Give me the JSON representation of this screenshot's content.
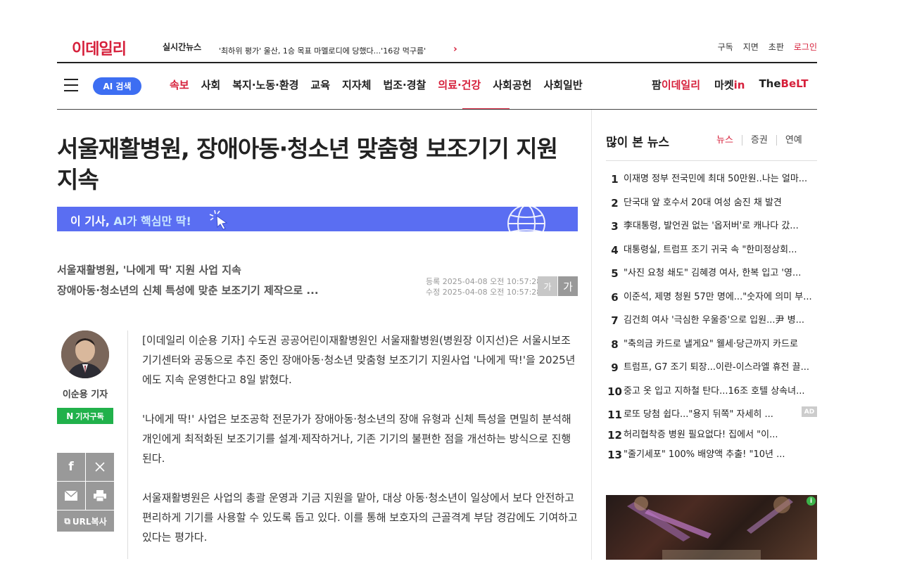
{
  "header": {
    "logo": "이데일리",
    "live_label": "실시간뉴스",
    "live_ticker": "'최하위 평가' 울산, 1승 목표 마멜로디에 당했다...'16강 먹구름'",
    "live_ticker_prev": "",
    "util_links": [
      "구독",
      "지면",
      "초판"
    ],
    "login": "로그인"
  },
  "nav": {
    "ai_search": "AI 검색",
    "items": [
      "속보",
      "사회",
      "복지·노동·환경",
      "교육",
      "지자체",
      "법조·경찰",
      "의료·건강",
      "사회공헌",
      "사회일반"
    ],
    "active_item": "의료·건강",
    "brands": {
      "pharm_prefix": "팜",
      "pharm_suffix": "이데일리",
      "market_prefix": "마켓",
      "market_suffix": "in",
      "belt_prefix": "The",
      "belt_suffix": "BeLT"
    }
  },
  "article": {
    "headline": "서울재활병원, 장애아동·청소년 맞춤형 보조기기 지원 지속",
    "ai_banner_prefix": "이 기사, ",
    "ai_banner_emph": "AI가 핵심만 딱!",
    "subhead_1": "서울재활병원, '나에게 딱' 지원 사업 지속",
    "subhead_2": "장애아동·청소년의 신체 특성에 맞춘 보조기기 제작으로 ...",
    "registered": "등록 2025-04-08 오전 10:57:28",
    "modified": "수정 2025-04-08 오전 10:57:28",
    "font_small": "가",
    "font_large": "가",
    "author": "이순용 기자",
    "subscribe": "기자구독",
    "url_copy": "URL복사",
    "paragraphs": [
      "[이데일리 이순용 기자] 수도권 공공어린이재활병원인 서울재활병원(병원장 이지선)은 서울시보조기기센터와 공동으로 추진 중인 장애아동·청소년 맞춤형 보조기기 지원사업 '나에게 딱!'을 2025년에도 지속 운영한다고 8일 밝혔다.",
      "'나에게 딱!' 사업은 보조공학 전문가가 장애아동·청소년의 장애 유형과 신체 특성을 면밀히 분석해 개인에게 최적화된 보조기기를 설계·제작하거나, 기존 기기의 불편한 점을 개선하는 방식으로 진행된다.",
      "서울재활병원은 사업의 총괄 운영과 기금 지원을 맡아, 대상 아동·청소년이 일상에서 보다 안전하고 편리하게 기기를 사용할 수 있도록 돕고 있다. 이를 통해 보호자의 근골격계 부담 경감에도 기여하고 있다는 평가다."
    ]
  },
  "popular": {
    "title": "많이 본 뉴스",
    "tabs": [
      "뉴스",
      "증권",
      "연예"
    ],
    "items": [
      {
        "rank": "1",
        "text": "이재명 정부 전국민에 최대 50만원..나는 얼마..."
      },
      {
        "rank": "2",
        "text": "단국대 앞 호수서 20대 여성 숨진 채 발견"
      },
      {
        "rank": "3",
        "text": "李대통령, 발언권 없는 '옵저버'로 캐나다 갔..."
      },
      {
        "rank": "4",
        "text": "대통령실, 트럼프 조기 귀국 속 \"한미정상회..."
      },
      {
        "rank": "5",
        "text": "\"사진 요청 쇄도\" 김혜경 여사, 한복 입고 '영..."
      },
      {
        "rank": "6",
        "text": "이준석, 제명 청원 57만 명에...\"숫자에 의미 부..."
      },
      {
        "rank": "7",
        "text": "김건희 여사 '극심한 우울증'으로 입원...尹 병..."
      },
      {
        "rank": "8",
        "text": "\"축의금 카드로 낼게요\" 웰세·당근까지 카드로"
      },
      {
        "rank": "9",
        "text": "트럼프, G7 조기 퇴장...이란-이스라엘 휴전 끌..."
      },
      {
        "rank": "10",
        "text": "중고 옷 입고 지하철 탄다...16조 호텔 상속녀..."
      }
    ],
    "ad_items": [
      {
        "rank": "11",
        "text": "로또 당첨 쉽다...\"용지 뒤쪽\" 자세히 ..."
      },
      {
        "rank": "12",
        "text": "허리협착증 병원 필요없다! 집에서 \"이..."
      },
      {
        "rank": "13",
        "text": "\"줄기세포\" 100% 배양액 추출! \"10년 ..."
      }
    ],
    "ad_badge": "AD"
  },
  "ad_banner": {
    "info_icon": "i"
  }
}
